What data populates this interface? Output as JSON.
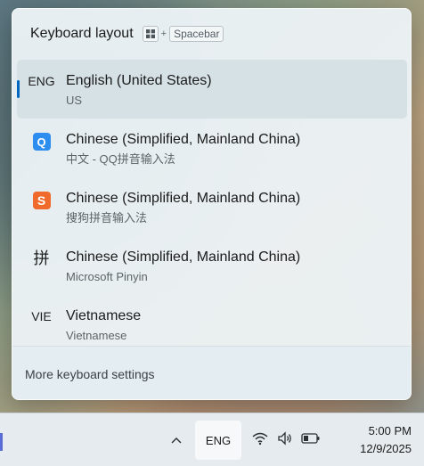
{
  "flyout": {
    "title": "Keyboard layout",
    "shortcut_plus": "+",
    "shortcut_key": "Spacebar",
    "footer_link": "More keyboard settings"
  },
  "layouts": [
    {
      "code": "ENG",
      "name": "English (United States)",
      "sub": "US",
      "icon": "text-code",
      "selected": true
    },
    {
      "code": "Q",
      "name": "Chinese (Simplified, Mainland China)",
      "sub": "中文 - QQ拼音输入法",
      "icon": "qq-pinyin-icon"
    },
    {
      "code": "S",
      "name": "Chinese (Simplified, Mainland China)",
      "sub": "搜狗拼音输入法",
      "icon": "sogou-pinyin-icon"
    },
    {
      "code": "拼",
      "name": "Chinese (Simplified, Mainland China)",
      "sub": "Microsoft Pinyin",
      "icon": "microsoft-pinyin-icon"
    },
    {
      "code": "VIE",
      "name": "Vietnamese",
      "sub": "Vietnamese",
      "icon": "text-code"
    }
  ],
  "taskbar": {
    "language": "ENG",
    "time": "5:00 PM",
    "date": "12/9/2025"
  },
  "colors": {
    "accent": "#0067c0",
    "qq": "#2e8ef0",
    "sogou": "#f06a2c"
  }
}
